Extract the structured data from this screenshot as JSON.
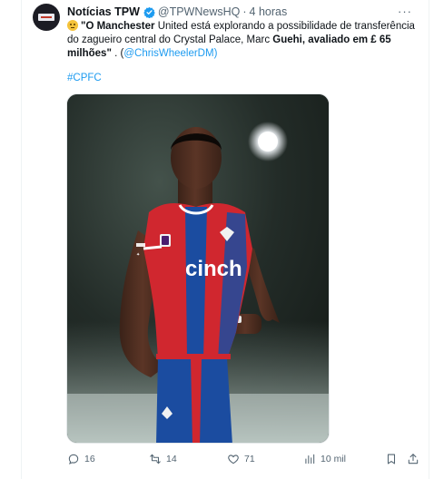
{
  "tweet": {
    "display_name": "Notícias TPW",
    "handle": "@TPWNewsHQ",
    "separator": "·",
    "time": "4 horas",
    "more_label": "···",
    "text_parts": {
      "p1": "\"O Manchester",
      "p2": " United está explorando a possibilidade de transferência do zagueiro central do Crystal Palace, Marc ",
      "p3": "Guehi",
      "p4": ", avaliado em £ 65 milhões\"",
      "p5": " . (",
      "mention": "@ChrisWheelerDM",
      "p6": ")"
    },
    "hashtag": "#CPFC",
    "media_alt": "Jogador do Crystal Palace em campo",
    "kit_sponsor": "cinch",
    "verified_color": "#1d9bf0"
  },
  "actions": {
    "replies": "16",
    "reposts": "14",
    "likes": "71",
    "views": "10 mil"
  },
  "colors": {
    "accent": "#1d9bf0",
    "secondary_text": "#536471",
    "kit_red": "#d0272f",
    "kit_blue": "#1b4ca0"
  }
}
